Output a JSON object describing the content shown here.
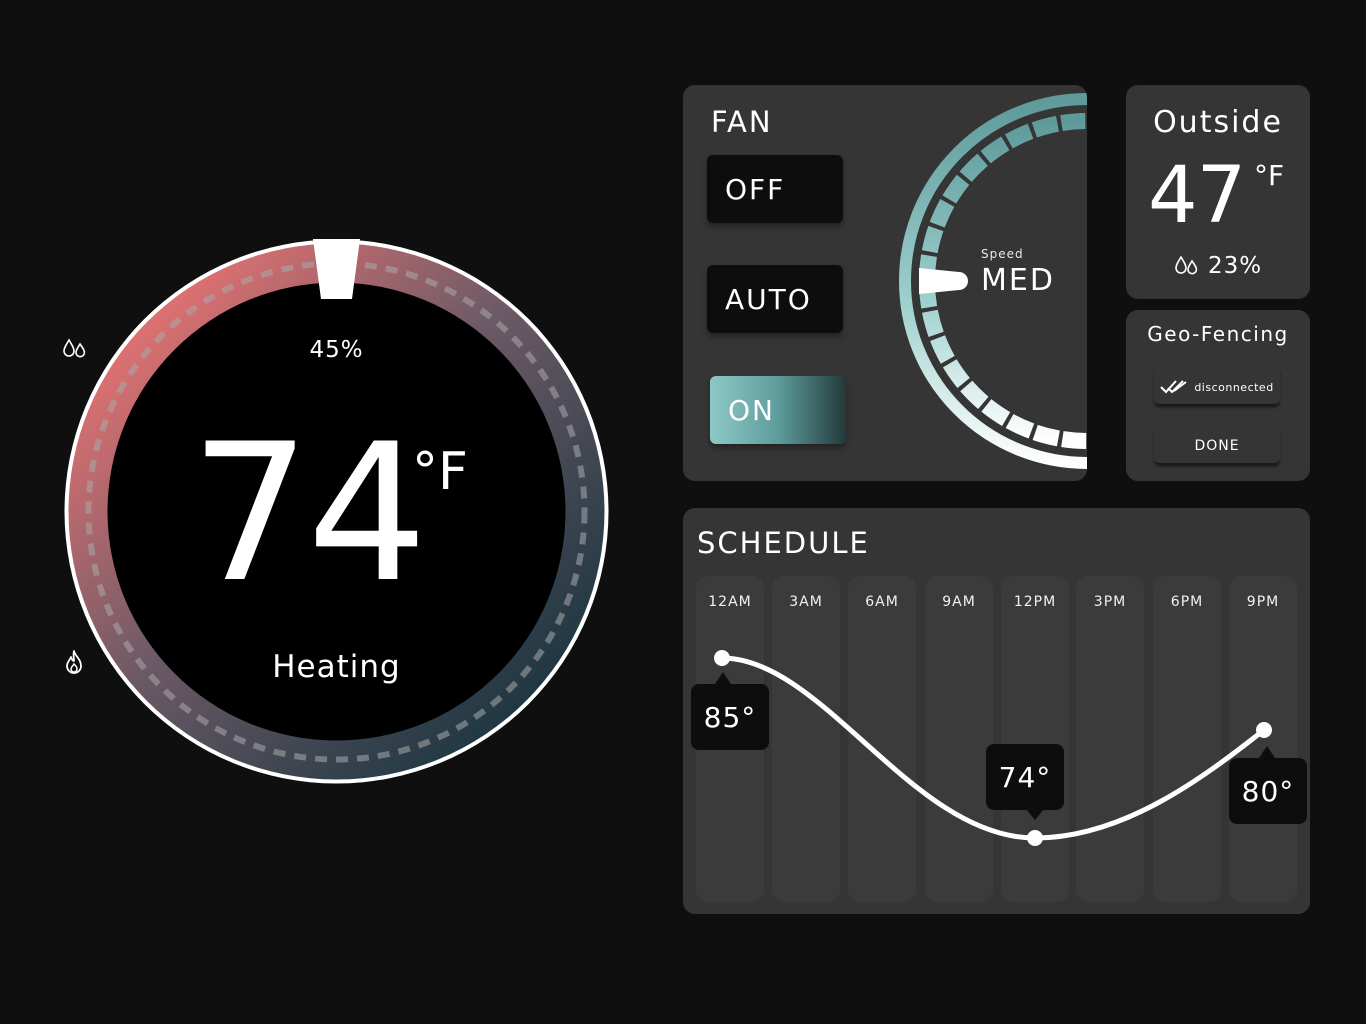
{
  "thermostat": {
    "humidity": "45%",
    "temperature": "74",
    "unit": "°F",
    "mode": "Heating",
    "colors": {
      "warm": "#e07072",
      "cool": "#1f3a44",
      "ring": "#ffffff"
    }
  },
  "fan": {
    "title": "FAN",
    "buttons": [
      {
        "label": "OFF",
        "selected": false
      },
      {
        "label": "AUTO",
        "selected": false
      },
      {
        "label": "ON",
        "selected": true
      }
    ],
    "speed_label": "Speed",
    "speed_value": "MED"
  },
  "outside": {
    "title": "Outside",
    "temperature": "47",
    "unit": "°F",
    "humidity": "23%"
  },
  "geo_fencing": {
    "title": "Geo-Fencing",
    "status": "disconnected",
    "done_label": "DONE"
  },
  "schedule": {
    "title": "SCHEDULE",
    "times": [
      "12AM",
      "3AM",
      "6AM",
      "9AM",
      "12PM",
      "3PM",
      "6PM",
      "9PM"
    ],
    "points": [
      {
        "label": "85°"
      },
      {
        "label": "74°"
      },
      {
        "label": "80°"
      }
    ]
  }
}
